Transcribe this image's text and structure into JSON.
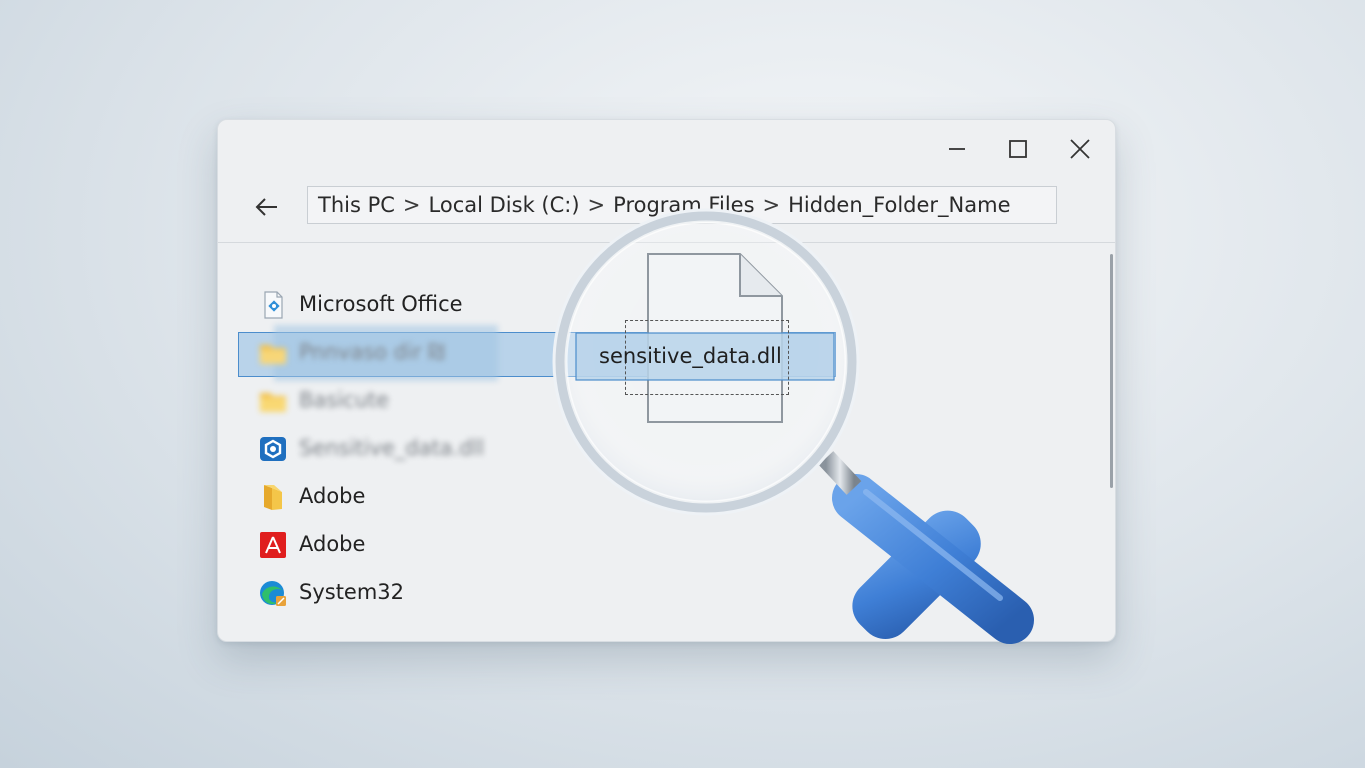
{
  "window": {
    "controls": {
      "minimize": "minimize-icon",
      "maximize": "maximize-icon",
      "close": "close-icon"
    },
    "back_icon": "arrow-left-icon"
  },
  "address_bar": {
    "crumbs": [
      "This PC",
      "Local Disk (C:)",
      "Program Files",
      "Hidden_Folder_Name"
    ],
    "separator": ">"
  },
  "files": [
    {
      "label": "Microsoft Office",
      "icon": "office-installer-icon",
      "blurred": false
    },
    {
      "label": "Pnnvaso dir ₪",
      "icon": "folder-icon",
      "blurred": true,
      "selected": true
    },
    {
      "label": "Basicute",
      "icon": "folder-icon",
      "blurred": true
    },
    {
      "label": "Sensitive_data.dll",
      "icon": "app-settings-icon",
      "blurred": true
    },
    {
      "label": "Adobe",
      "icon": "adobe-folder-icon",
      "blurred": false
    },
    {
      "label": "Adobe",
      "icon": "adobe-acrobat-icon",
      "blurred": false
    },
    {
      "label": "System32",
      "icon": "edge-globe-icon",
      "blurred": false
    }
  ],
  "magnifier": {
    "label": "sensitive_data.dll",
    "icon": "magnifying-glass-icon",
    "file_icon": "document-icon"
  },
  "colors": {
    "selection_fill": "#b9d3ea",
    "selection_border": "#4c8dcc",
    "handle_blue": "#3f7fd6",
    "folder_yellow": "#f5c94f"
  }
}
